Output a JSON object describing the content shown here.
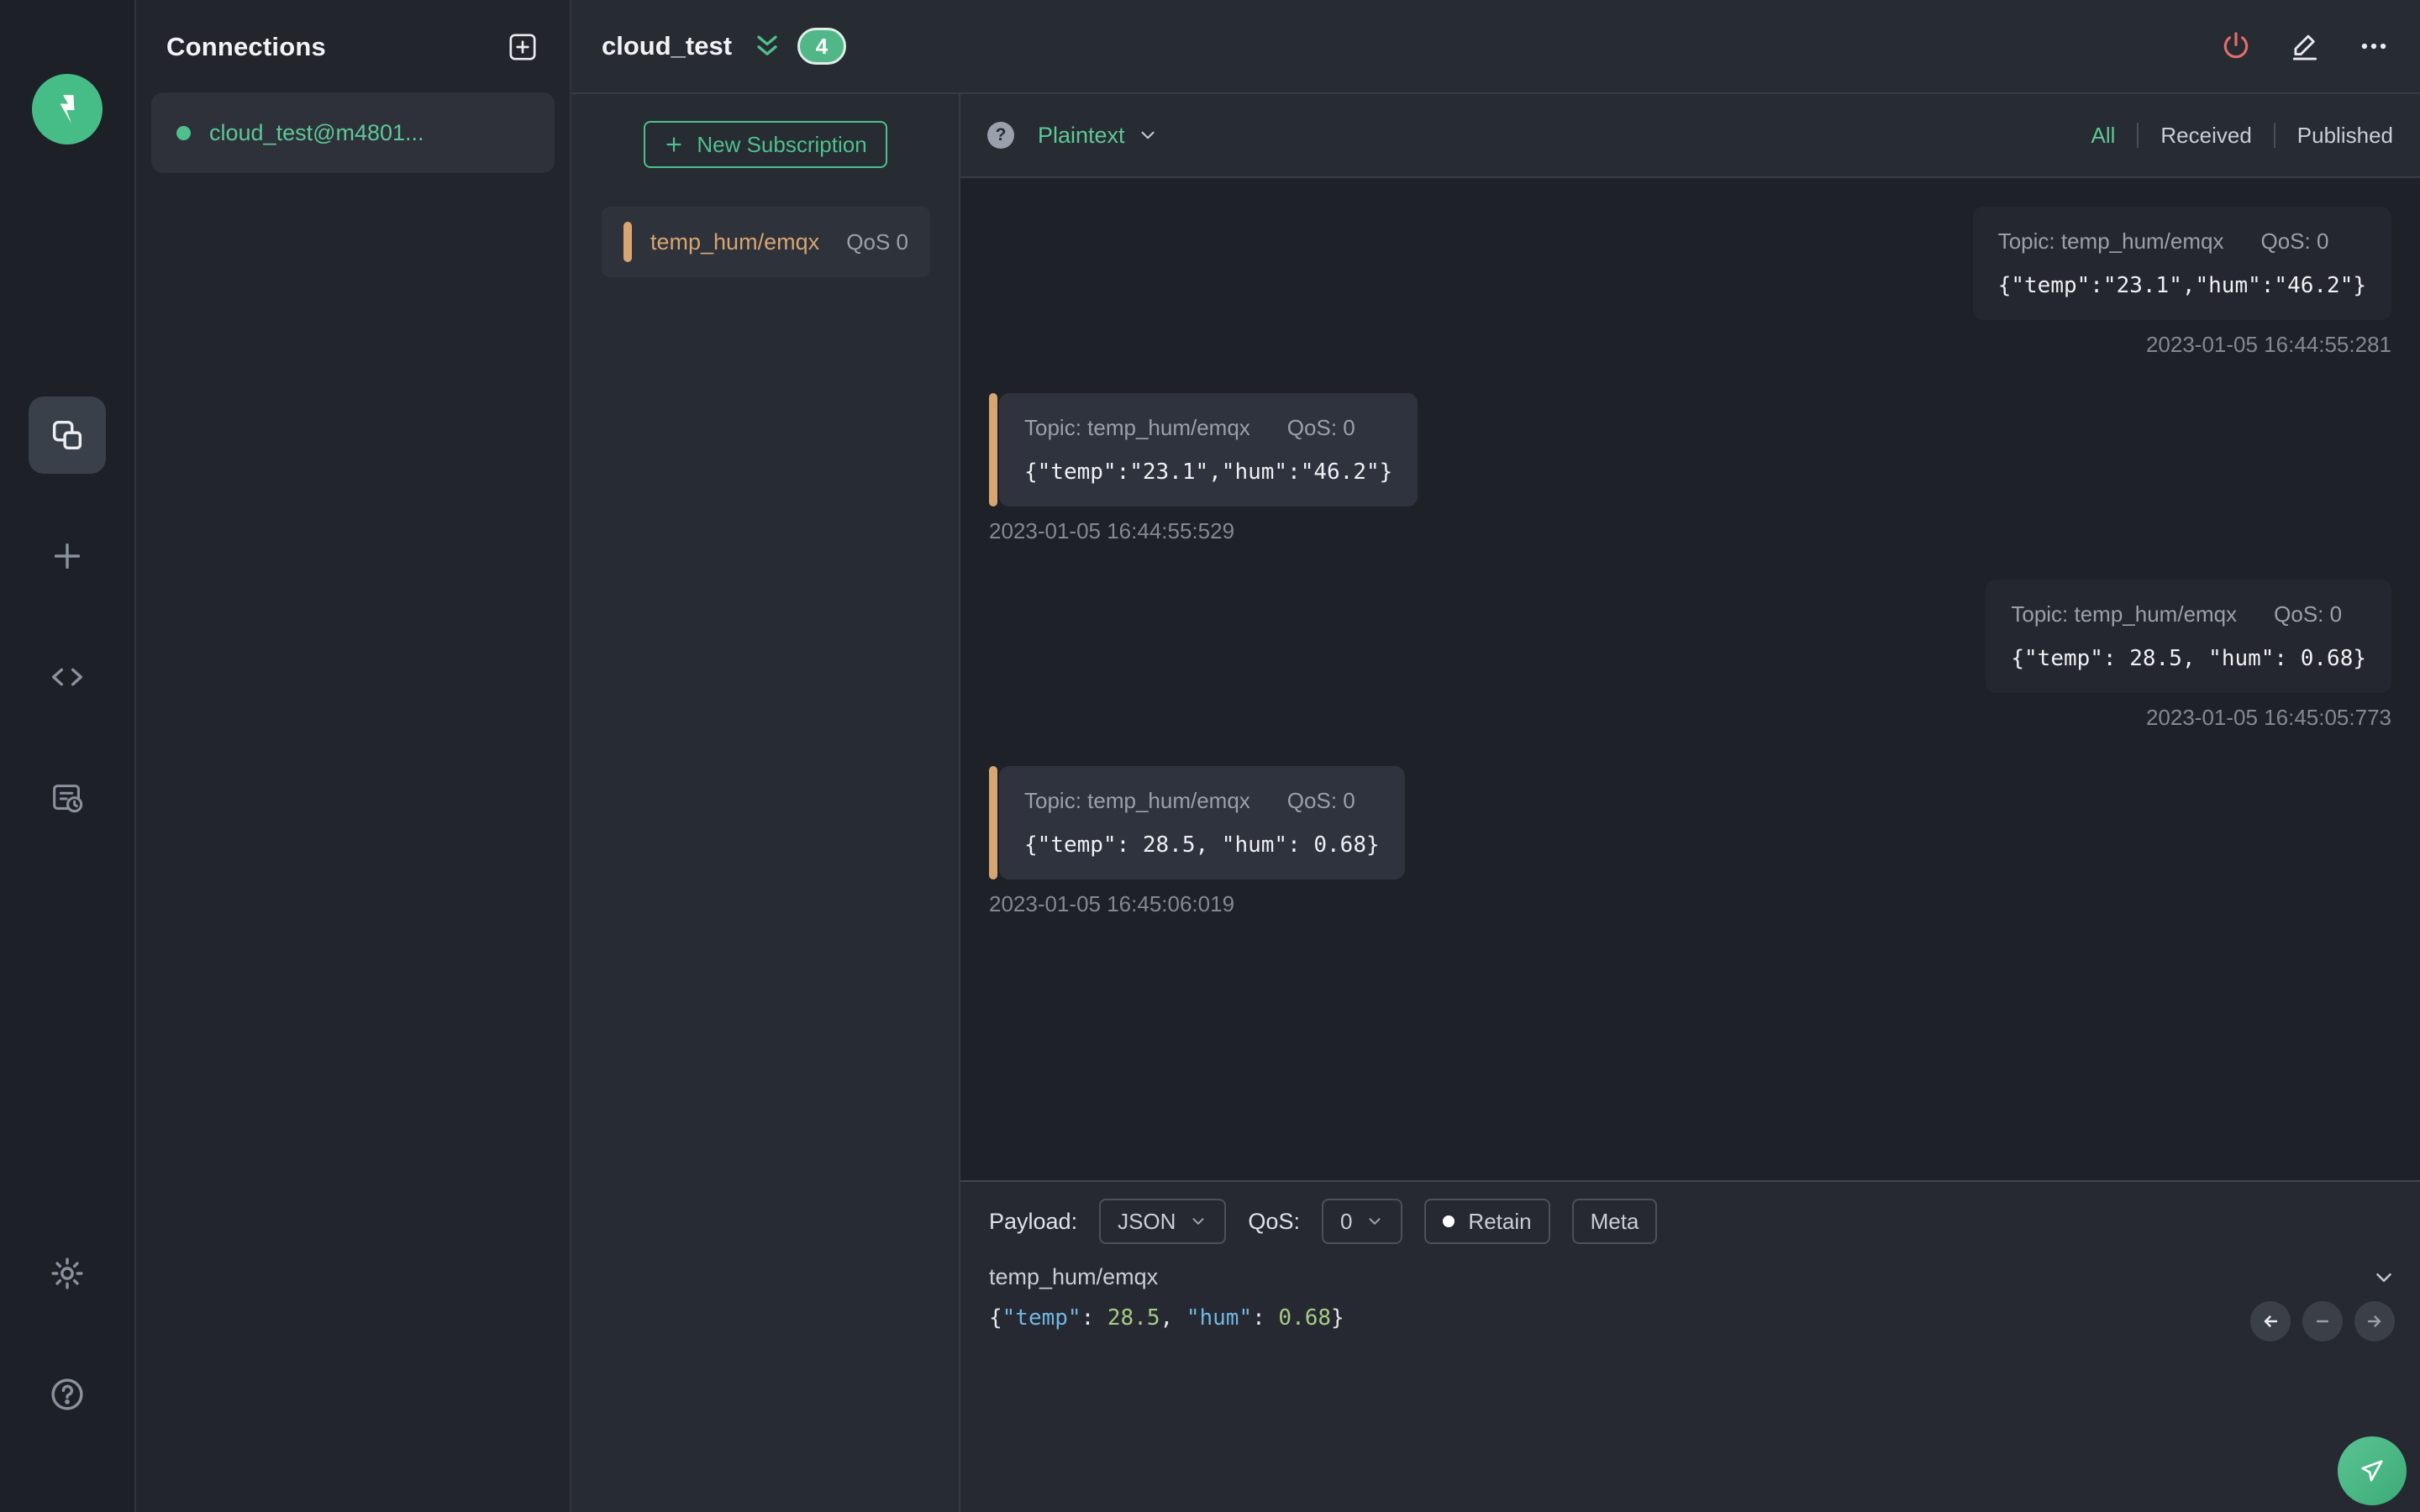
{
  "colors": {
    "accent_green": "#4ec08d",
    "marker_orange": "#d7a571",
    "disconnect_coral": "#e36d6d",
    "panel_dark": "#272b32",
    "list_dark": "#1e2127"
  },
  "icons": {
    "app_logo": "mqttx-bolt",
    "sidebar": [
      "connections",
      "plus",
      "code",
      "script-log",
      "settings-gear",
      "help-circle"
    ],
    "titlebar": [
      "power",
      "pencil-edit",
      "ellipsis-more"
    ],
    "misc": [
      "double-chevron-down",
      "chevron-down",
      "question-bubble",
      "paper-plane-send",
      "arrow-left",
      "minus",
      "arrow-right"
    ]
  },
  "connections": {
    "title": "Connections",
    "items": [
      {
        "name": "cloud_test@m4801...",
        "status": "connected"
      }
    ]
  },
  "header": {
    "title": "cloud_test",
    "badge": "4"
  },
  "subscriptions": {
    "new_button_label": "New Subscription",
    "items": [
      {
        "topic": "temp_hum/emqx",
        "qos": "QoS 0"
      }
    ]
  },
  "messages": {
    "format_label": "Plaintext",
    "filters": [
      {
        "label": "All",
        "active": true
      },
      {
        "label": "Received",
        "active": false
      },
      {
        "label": "Published",
        "active": false
      }
    ],
    "items": [
      {
        "direction": "published",
        "topic_label": "Topic: temp_hum/emqx",
        "qos_label": "QoS: 0",
        "payload": "{\"temp\":\"23.1\",\"hum\":\"46.2\"}",
        "timestamp": "2023-01-05 16:44:55:281"
      },
      {
        "direction": "received",
        "topic_label": "Topic: temp_hum/emqx",
        "qos_label": "QoS: 0",
        "payload": "{\"temp\":\"23.1\",\"hum\":\"46.2\"}",
        "timestamp": "2023-01-05 16:44:55:529"
      },
      {
        "direction": "published",
        "topic_label": "Topic: temp_hum/emqx",
        "qos_label": "QoS: 0",
        "payload": "{\"temp\": 28.5, \"hum\": 0.68}",
        "timestamp": "2023-01-05 16:45:05:773"
      },
      {
        "direction": "received",
        "topic_label": "Topic: temp_hum/emqx",
        "qos_label": "QoS: 0",
        "payload": "{\"temp\": 28.5, \"hum\": 0.68}",
        "timestamp": "2023-01-05 16:45:06:019"
      }
    ]
  },
  "publish": {
    "payload_label": "Payload:",
    "payload_type": "JSON",
    "qos_label": "QoS:",
    "qos_value": "0",
    "retain_label": "Retain",
    "meta_label": "Meta",
    "topic": "temp_hum/emqx",
    "editor": {
      "tokens": [
        {
          "t": "{"
        },
        {
          "t": "\"temp\""
        },
        {
          "t": ": "
        },
        {
          "t": "28.5"
        },
        {
          "t": ", "
        },
        {
          "t": "\"hum\""
        },
        {
          "t": ": "
        },
        {
          "t": "0.68"
        },
        {
          "t": "}"
        }
      ]
    }
  }
}
